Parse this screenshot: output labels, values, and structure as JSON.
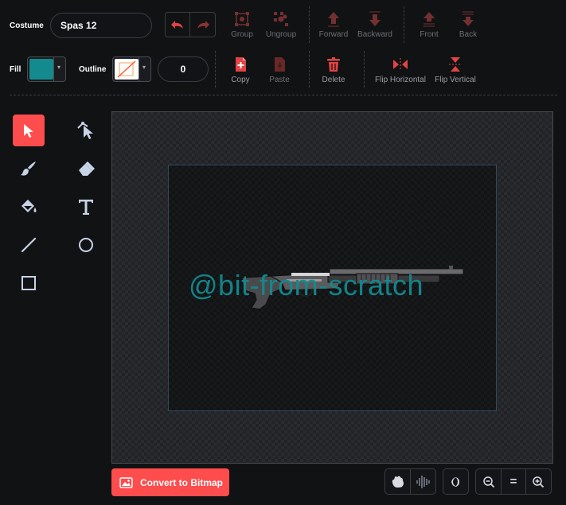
{
  "costume": {
    "label": "Costume",
    "name": "Spas 12"
  },
  "history": {
    "undo_icon": "undo-icon",
    "redo_icon": "redo-icon"
  },
  "arrange_tools": [
    {
      "label": "Group",
      "icon": "group-icon",
      "enabled": false
    },
    {
      "label": "Ungroup",
      "icon": "ungroup-icon",
      "enabled": false
    },
    {
      "label": "Forward",
      "icon": "forward-icon",
      "enabled": false
    },
    {
      "label": "Backward",
      "icon": "backward-icon",
      "enabled": false
    },
    {
      "label": "Front",
      "icon": "front-icon",
      "enabled": false
    },
    {
      "label": "Back",
      "icon": "back-icon",
      "enabled": false
    }
  ],
  "fill": {
    "label": "Fill",
    "color": "#138a8e"
  },
  "outline": {
    "label": "Outline",
    "color": "none",
    "width": "0"
  },
  "edit_tools": [
    {
      "label": "Copy",
      "icon": "copy-icon",
      "enabled": true
    },
    {
      "label": "Paste",
      "icon": "paste-icon",
      "enabled": false
    },
    {
      "label": "Delete",
      "icon": "delete-icon",
      "enabled": true
    },
    {
      "label": "Flip Horizontal",
      "icon": "flip-horizontal-icon",
      "enabled": true
    },
    {
      "label": "Flip Vertical",
      "icon": "flip-vertical-icon",
      "enabled": true
    }
  ],
  "paint_tools": [
    {
      "name": "select",
      "icon": "select-arrow-icon",
      "active": true
    },
    {
      "name": "reshape",
      "icon": "reshape-icon",
      "active": false
    },
    {
      "name": "brush",
      "icon": "brush-icon",
      "active": false
    },
    {
      "name": "eraser",
      "icon": "eraser-icon",
      "active": false
    },
    {
      "name": "fill",
      "icon": "paint-bucket-icon",
      "active": false
    },
    {
      "name": "text",
      "icon": "text-icon",
      "active": false
    },
    {
      "name": "line",
      "icon": "line-icon",
      "active": false
    },
    {
      "name": "circle",
      "icon": "circle-icon",
      "active": false
    },
    {
      "name": "rectangle",
      "icon": "rectangle-icon",
      "active": false
    }
  ],
  "canvas": {
    "watermark": "@bit-from-scratch"
  },
  "footer": {
    "convert_label": "Convert to Bitmap",
    "zoom": {
      "out": "zoom-out-icon",
      "reset": "=",
      "in": "zoom-in-icon"
    }
  },
  "colors": {
    "accent": "#ff4c4c",
    "background": "#111214",
    "icon_red": "#d23b3b"
  }
}
